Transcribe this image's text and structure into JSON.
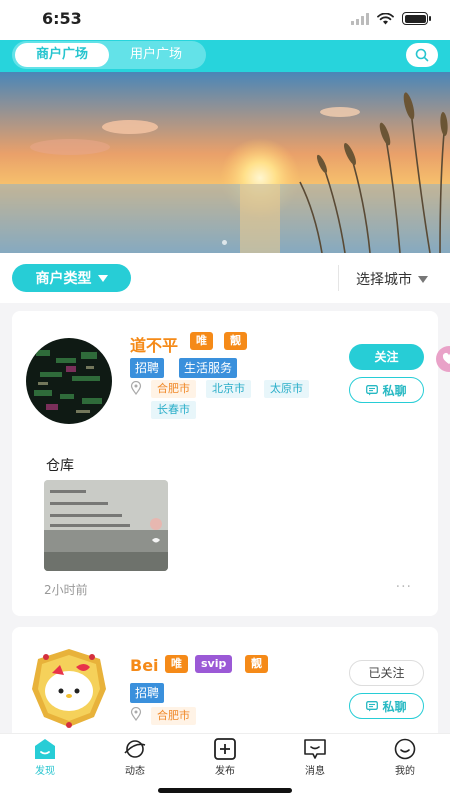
{
  "status_bar": {
    "time": "6:53"
  },
  "header": {
    "tabs": [
      {
        "label": "商户广场",
        "active": true
      },
      {
        "label": "用户广场",
        "active": false
      }
    ],
    "search_icon": "search-icon",
    "accent_color": "#27d4dc"
  },
  "filter": {
    "merchant_type_label": "商户类型",
    "city_select_label": "选择城市"
  },
  "merchants": [
    {
      "name": "道不平",
      "badges": [
        "唯",
        "靓"
      ],
      "categories": [
        "招聘",
        "生活服务"
      ],
      "cities": [
        "合肥市",
        "北京市",
        "太原市",
        "长春市"
      ],
      "follow_label": "关注",
      "message_label": "私聊",
      "post": {
        "text": "仓库",
        "time": "2小时前",
        "more": "···"
      }
    },
    {
      "name": "Bei",
      "badges": [
        "唯",
        "svip",
        "靓"
      ],
      "categories": [
        "招聘"
      ],
      "cities": [
        "合肥市"
      ],
      "follow_label": "已关注",
      "message_label": "私聊"
    }
  ],
  "bottom_nav": [
    {
      "label": "发现",
      "icon": "discover-icon",
      "active": true
    },
    {
      "label": "动态",
      "icon": "planet-icon",
      "active": false
    },
    {
      "label": "发布",
      "icon": "add-icon",
      "active": false
    },
    {
      "label": "消息",
      "icon": "message-icon",
      "active": false
    },
    {
      "label": "我的",
      "icon": "profile-icon",
      "active": false
    }
  ]
}
